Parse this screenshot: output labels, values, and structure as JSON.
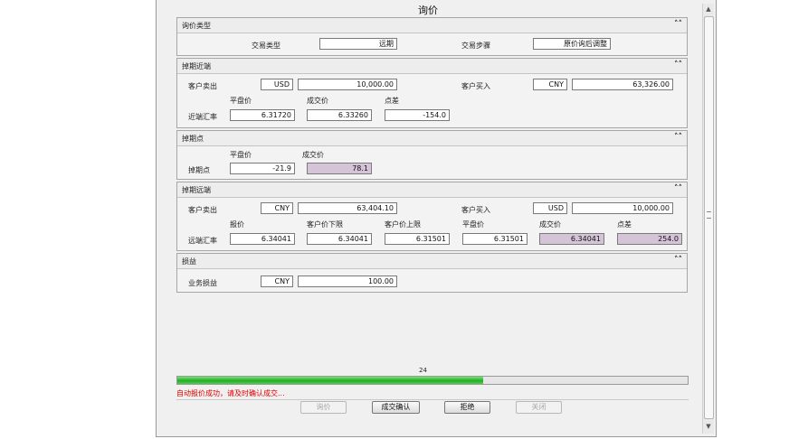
{
  "window": {
    "title": "询价"
  },
  "panels": {
    "inquiry_type": {
      "title": "询价类型",
      "trade_type_label": "交易类型",
      "trade_type_value": "远期",
      "trade_step_label": "交易步骤",
      "trade_step_value": "原价询后调整"
    },
    "near_leg": {
      "title": "掉期近端",
      "customer_sell_label": "客户卖出",
      "customer_sell_currency": "USD",
      "customer_sell_amount": "10,000.00",
      "customer_buy_label": "客户买入",
      "customer_buy_currency": "CNY",
      "customer_buy_amount": "63,326.00",
      "rate_label": "近端汇率",
      "col_mid": "平盘价",
      "col_deal": "成交价",
      "col_spread": "点差",
      "mid_value": "6.31720",
      "deal_value": "6.33260",
      "spread_value": "-154.0"
    },
    "swap_points": {
      "title": "掉期点",
      "row_label": "掉期点",
      "col_mid": "平盘价",
      "col_deal": "成交价",
      "mid_value": "-21.9",
      "deal_value": "78.1"
    },
    "far_leg": {
      "title": "掉期远端",
      "customer_sell_label": "客户卖出",
      "customer_sell_currency": "CNY",
      "customer_sell_amount": "63,404.10",
      "customer_buy_label": "客户买入",
      "customer_buy_currency": "USD",
      "customer_buy_amount": "10,000.00",
      "rate_label": "远端汇率",
      "col_quote": "报价",
      "col_lower": "客户价下限",
      "col_upper": "客户价上限",
      "col_mid": "平盘价",
      "col_deal": "成交价",
      "col_spread": "点差",
      "quote_value": "6.34041",
      "lower_value": "6.34041",
      "upper_value": "6.31501",
      "mid_value": "6.31501",
      "deal_value": "6.34041",
      "spread_value": "254.0"
    },
    "pnl": {
      "title": "损益",
      "row_label": "业务损益",
      "currency": "CNY",
      "amount": "100.00"
    }
  },
  "progress": {
    "count": "24",
    "fraction": 0.6
  },
  "status": {
    "message": "自动报价成功，请及时确认成交..."
  },
  "buttons": {
    "inquiry": "询价",
    "confirm": "成交确认",
    "reject": "拒绝",
    "close": "关闭"
  },
  "icons": {
    "collapse": "double-chevron-up-icon"
  },
  "colors": {
    "progress": "#22b022",
    "status_error": "#e00000",
    "highlight": "#d5c4d8"
  }
}
